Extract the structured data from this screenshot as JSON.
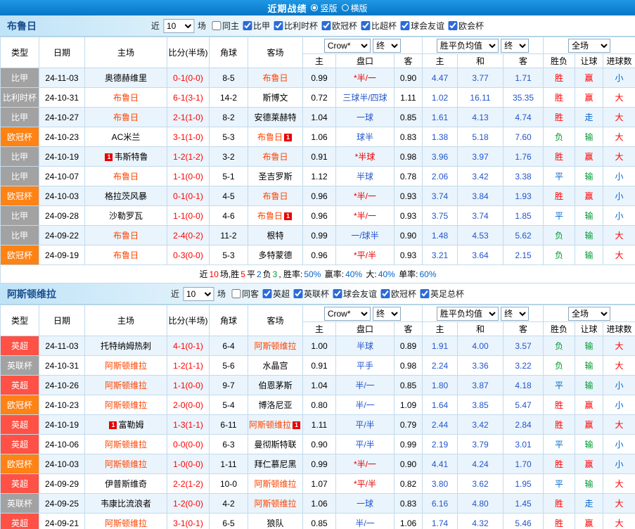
{
  "topbar": {
    "title": "近期战绩",
    "radio_vertical": "竖版",
    "radio_horizontal": "横版"
  },
  "colors": {
    "topbar_bg": "#0b82d2",
    "border": "#c2dbec",
    "row_alt": "#eaf4fc",
    "focus_team": "#ff4400",
    "score": "#ff0000",
    "handicap_normal": "#2255cc",
    "handicap_star": "#e60000",
    "euro_odds": "#2255cc",
    "card_badge": "#e80000"
  },
  "league_colors": {
    "比甲": "#a2a2a2",
    "比利时杯": "#a2a2a2",
    "英联杯": "#a2a2a2",
    "欧冠杯": "#ff8214",
    "英超": "#ff5145"
  },
  "result_colors": {
    "胜": "#ff0000",
    "赢": "#ff0000",
    "大": "#ff0000",
    "平": "#0066cc",
    "走": "#0066cc",
    "小": "#0066cc",
    "负": "#009933",
    "输": "#009933"
  },
  "sections": [
    {
      "team": "布鲁日",
      "filter": {
        "recent_label": "近",
        "count": "10",
        "matches_label": "场",
        "checkboxes": [
          {
            "label": "同主",
            "checked": false
          },
          {
            "label": "比甲",
            "checked": true
          },
          {
            "label": "比利时杯",
            "checked": true
          },
          {
            "label": "欧冠杯",
            "checked": true
          },
          {
            "label": "比超杯",
            "checked": true
          },
          {
            "label": "球会友谊",
            "checked": true
          },
          {
            "label": "欧会杯",
            "checked": true
          }
        ]
      },
      "header": {
        "type": "类型",
        "date": "日期",
        "home": "主场",
        "score": "比分(半场)",
        "corner": "角球",
        "away": "客场",
        "odds_select": "Crow*",
        "final_select": "终",
        "asia_home": "主",
        "handicap": "盘口",
        "asia_away": "客",
        "euro_select": "胜平负均值",
        "final_select2": "终",
        "euro_home": "主",
        "euro_draw": "和",
        "euro_away": "客",
        "full_select": "全场",
        "res_wdl": "胜负",
        "res_handicap": "让球",
        "res_goals": "进球数"
      },
      "rows": [
        {
          "league": "比甲",
          "date": "24-11-03",
          "home": "奥德赫维里",
          "home_focus": false,
          "home_card": "",
          "score": "0-1(0-0)",
          "corner": "8-5",
          "away": "布鲁日",
          "away_focus": true,
          "away_card": "",
          "asia_home": "0.99",
          "handicap": "*半/一",
          "asia_away": "0.90",
          "euro_home": "4.47",
          "euro_draw": "3.77",
          "euro_away": "1.71",
          "wdl": "胜",
          "let": "赢",
          "goal": "小"
        },
        {
          "league": "比利时杯",
          "date": "24-10-31",
          "home": "布鲁日",
          "home_focus": true,
          "home_card": "",
          "score": "6-1(3-1)",
          "corner": "14-2",
          "away": "斯博文",
          "away_focus": false,
          "away_card": "",
          "asia_home": "0.72",
          "handicap": "三球半/四球",
          "asia_away": "1.11",
          "euro_home": "1.02",
          "euro_draw": "16.11",
          "euro_away": "35.35",
          "wdl": "胜",
          "let": "赢",
          "goal": "大"
        },
        {
          "league": "比甲",
          "date": "24-10-27",
          "home": "布鲁日",
          "home_focus": true,
          "home_card": "",
          "score": "2-1(1-0)",
          "corner": "8-2",
          "away": "安德莱赫特",
          "away_focus": false,
          "away_card": "",
          "asia_home": "1.04",
          "handicap": "一球",
          "asia_away": "0.85",
          "euro_home": "1.61",
          "euro_draw": "4.13",
          "euro_away": "4.74",
          "wdl": "胜",
          "let": "走",
          "goal": "大"
        },
        {
          "league": "欧冠杯",
          "date": "24-10-23",
          "home": "AC米兰",
          "home_focus": false,
          "home_card": "",
          "score": "3-1(1-0)",
          "corner": "5-3",
          "away": "布鲁日",
          "away_focus": true,
          "away_card": "1",
          "asia_home": "1.06",
          "handicap": "球半",
          "asia_away": "0.83",
          "euro_home": "1.38",
          "euro_draw": "5.18",
          "euro_away": "7.60",
          "wdl": "负",
          "let": "输",
          "goal": "大"
        },
        {
          "league": "比甲",
          "date": "24-10-19",
          "home": "韦斯特鲁",
          "home_focus": false,
          "home_card": "1",
          "score": "1-2(1-2)",
          "corner": "3-2",
          "away": "布鲁日",
          "away_focus": true,
          "away_card": "",
          "asia_home": "0.91",
          "handicap": "*半球",
          "asia_away": "0.98",
          "euro_home": "3.96",
          "euro_draw": "3.97",
          "euro_away": "1.76",
          "wdl": "胜",
          "let": "赢",
          "goal": "大"
        },
        {
          "league": "比甲",
          "date": "24-10-07",
          "home": "布鲁日",
          "home_focus": true,
          "home_card": "",
          "score": "1-1(0-0)",
          "corner": "5-1",
          "away": "圣吉罗斯",
          "away_focus": false,
          "away_card": "",
          "asia_home": "1.12",
          "handicap": "半球",
          "asia_away": "0.78",
          "euro_home": "2.06",
          "euro_draw": "3.42",
          "euro_away": "3.38",
          "wdl": "平",
          "let": "输",
          "goal": "小"
        },
        {
          "league": "欧冠杯",
          "date": "24-10-03",
          "home": "格拉茨风暴",
          "home_focus": false,
          "home_card": "",
          "score": "0-1(0-1)",
          "corner": "4-5",
          "away": "布鲁日",
          "away_focus": true,
          "away_card": "",
          "asia_home": "0.96",
          "handicap": "*半/一",
          "asia_away": "0.93",
          "euro_home": "3.74",
          "euro_draw": "3.84",
          "euro_away": "1.93",
          "wdl": "胜",
          "let": "赢",
          "goal": "小"
        },
        {
          "league": "比甲",
          "date": "24-09-28",
          "home": "沙勒罗瓦",
          "home_focus": false,
          "home_card": "",
          "score": "1-1(0-0)",
          "corner": "4-6",
          "away": "布鲁日",
          "away_focus": true,
          "away_card": "1",
          "asia_home": "0.96",
          "handicap": "*半/一",
          "asia_away": "0.93",
          "euro_home": "3.75",
          "euro_draw": "3.74",
          "euro_away": "1.85",
          "wdl": "平",
          "let": "输",
          "goal": "小"
        },
        {
          "league": "比甲",
          "date": "24-09-22",
          "home": "布鲁日",
          "home_focus": true,
          "home_card": "",
          "score": "2-4(0-2)",
          "corner": "11-2",
          "away": "根特",
          "away_focus": false,
          "away_card": "",
          "asia_home": "0.99",
          "handicap": "一/球半",
          "asia_away": "0.90",
          "euro_home": "1.48",
          "euro_draw": "4.53",
          "euro_away": "5.62",
          "wdl": "负",
          "let": "输",
          "goal": "大"
        },
        {
          "league": "欧冠杯",
          "date": "24-09-19",
          "home": "布鲁日",
          "home_focus": true,
          "home_card": "",
          "score": "0-3(0-0)",
          "corner": "5-3",
          "away": "多特蒙德",
          "away_focus": false,
          "away_card": "",
          "asia_home": "0.96",
          "handicap": "*平/半",
          "asia_away": "0.93",
          "euro_home": "3.21",
          "euro_draw": "3.64",
          "euro_away": "2.15",
          "wdl": "负",
          "let": "输",
          "goal": "大"
        }
      ],
      "summary": [
        {
          "t": "近",
          "c": "#000000"
        },
        {
          "t": "10",
          "c": "#ff0000"
        },
        {
          "t": "场,胜",
          "c": "#000000"
        },
        {
          "t": "5",
          "c": "#ff0000"
        },
        {
          "t": "平",
          "c": "#000000"
        },
        {
          "t": "2",
          "c": "#0066cc"
        },
        {
          "t": "负",
          "c": "#000000"
        },
        {
          "t": "3",
          "c": "#009933"
        },
        {
          "t": ", 胜率:",
          "c": "#000000"
        },
        {
          "t": "50%",
          "c": "#0066cc"
        },
        {
          "t": " 赢率:",
          "c": "#000000"
        },
        {
          "t": "40%",
          "c": "#0066cc"
        },
        {
          "t": " 大:",
          "c": "#000000"
        },
        {
          "t": "40%",
          "c": "#0066cc"
        },
        {
          "t": " 单率:",
          "c": "#000000"
        },
        {
          "t": "60%",
          "c": "#0066cc"
        }
      ]
    },
    {
      "team": "阿斯顿维拉",
      "filter": {
        "recent_label": "近",
        "count": "10",
        "matches_label": "场",
        "checkboxes": [
          {
            "label": "同客",
            "checked": false
          },
          {
            "label": "英超",
            "checked": true
          },
          {
            "label": "英联杯",
            "checked": true
          },
          {
            "label": "球会友谊",
            "checked": true
          },
          {
            "label": "欧冠杯",
            "checked": true
          },
          {
            "label": "英足总杯",
            "checked": true
          }
        ]
      },
      "header": {
        "type": "类型",
        "date": "日期",
        "home": "主场",
        "score": "比分(半场)",
        "corner": "角球",
        "away": "客场",
        "odds_select": "Crow*",
        "final_select": "终",
        "asia_home": "主",
        "handicap": "盘口",
        "asia_away": "客",
        "euro_select": "胜平负均值",
        "final_select2": "终",
        "euro_home": "主",
        "euro_draw": "和",
        "euro_away": "客",
        "full_select": "全场",
        "res_wdl": "胜负",
        "res_handicap": "让球",
        "res_goals": "进球数"
      },
      "rows": [
        {
          "league": "英超",
          "date": "24-11-03",
          "home": "托特纳姆热刺",
          "home_focus": false,
          "home_card": "",
          "score": "4-1(0-1)",
          "corner": "6-4",
          "away": "阿斯顿维拉",
          "away_focus": true,
          "away_card": "",
          "asia_home": "1.00",
          "handicap": "半球",
          "asia_away": "0.89",
          "euro_home": "1.91",
          "euro_draw": "4.00",
          "euro_away": "3.57",
          "wdl": "负",
          "let": "输",
          "goal": "大"
        },
        {
          "league": "英联杯",
          "date": "24-10-31",
          "home": "阿斯顿维拉",
          "home_focus": true,
          "home_card": "",
          "score": "1-2(1-1)",
          "corner": "5-6",
          "away": "水晶宫",
          "away_focus": false,
          "away_card": "",
          "asia_home": "0.91",
          "handicap": "平手",
          "asia_away": "0.98",
          "euro_home": "2.24",
          "euro_draw": "3.36",
          "euro_away": "3.22",
          "wdl": "负",
          "let": "输",
          "goal": "大"
        },
        {
          "league": "英超",
          "date": "24-10-26",
          "home": "阿斯顿维拉",
          "home_focus": true,
          "home_card": "",
          "score": "1-1(0-0)",
          "corner": "9-7",
          "away": "伯恩茅斯",
          "away_focus": false,
          "away_card": "",
          "asia_home": "1.04",
          "handicap": "半/一",
          "asia_away": "0.85",
          "euro_home": "1.80",
          "euro_draw": "3.87",
          "euro_away": "4.18",
          "wdl": "平",
          "let": "输",
          "goal": "小"
        },
        {
          "league": "欧冠杯",
          "date": "24-10-23",
          "home": "阿斯顿维拉",
          "home_focus": true,
          "home_card": "",
          "score": "2-0(0-0)",
          "corner": "5-4",
          "away": "博洛尼亚",
          "away_focus": false,
          "away_card": "",
          "asia_home": "0.80",
          "handicap": "半/一",
          "asia_away": "1.09",
          "euro_home": "1.64",
          "euro_draw": "3.85",
          "euro_away": "5.47",
          "wdl": "胜",
          "let": "赢",
          "goal": "小"
        },
        {
          "league": "英超",
          "date": "24-10-19",
          "home": "富勒姆",
          "home_focus": false,
          "home_card": "1",
          "score": "1-3(1-1)",
          "corner": "6-11",
          "away": "阿斯顿维拉",
          "away_focus": true,
          "away_card": "1",
          "asia_home": "1.11",
          "handicap": "平/半",
          "asia_away": "0.79",
          "euro_home": "2.44",
          "euro_draw": "3.42",
          "euro_away": "2.84",
          "wdl": "胜",
          "let": "赢",
          "goal": "大"
        },
        {
          "league": "英超",
          "date": "24-10-06",
          "home": "阿斯顿维拉",
          "home_focus": true,
          "home_card": "",
          "score": "0-0(0-0)",
          "corner": "6-3",
          "away": "曼彻斯特联",
          "away_focus": false,
          "away_card": "",
          "asia_home": "0.90",
          "handicap": "平/半",
          "asia_away": "0.99",
          "euro_home": "2.19",
          "euro_draw": "3.79",
          "euro_away": "3.01",
          "wdl": "平",
          "let": "输",
          "goal": "小"
        },
        {
          "league": "欧冠杯",
          "date": "24-10-03",
          "home": "阿斯顿维拉",
          "home_focus": true,
          "home_card": "",
          "score": "1-0(0-0)",
          "corner": "1-11",
          "away": "拜仁慕尼黑",
          "away_focus": false,
          "away_card": "",
          "asia_home": "0.99",
          "handicap": "*半/一",
          "asia_away": "0.90",
          "euro_home": "4.41",
          "euro_draw": "4.24",
          "euro_away": "1.70",
          "wdl": "胜",
          "let": "赢",
          "goal": "小"
        },
        {
          "league": "英超",
          "date": "24-09-29",
          "home": "伊普斯维奇",
          "home_focus": false,
          "home_card": "",
          "score": "2-2(1-2)",
          "corner": "10-0",
          "away": "阿斯顿维拉",
          "away_focus": true,
          "away_card": "",
          "asia_home": "1.07",
          "handicap": "*平/半",
          "asia_away": "0.82",
          "euro_home": "3.80",
          "euro_draw": "3.62",
          "euro_away": "1.95",
          "wdl": "平",
          "let": "输",
          "goal": "大"
        },
        {
          "league": "英联杯",
          "date": "24-09-25",
          "home": "韦康比流浪者",
          "home_focus": false,
          "home_card": "",
          "score": "1-2(0-0)",
          "corner": "4-2",
          "away": "阿斯顿维拉",
          "away_focus": true,
          "away_card": "",
          "asia_home": "1.06",
          "handicap": "一球",
          "asia_away": "0.83",
          "euro_home": "6.16",
          "euro_draw": "4.80",
          "euro_away": "1.45",
          "wdl": "胜",
          "let": "走",
          "goal": "大"
        },
        {
          "league": "英超",
          "date": "24-09-21",
          "home": "阿斯顿维拉",
          "home_focus": true,
          "home_card": "",
          "score": "3-1(0-1)",
          "corner": "6-5",
          "away": "狼队",
          "away_focus": false,
          "away_card": "",
          "asia_home": "0.85",
          "handicap": "半/一",
          "asia_away": "1.06",
          "euro_home": "1.74",
          "euro_draw": "4.32",
          "euro_away": "5.46",
          "wdl": "胜",
          "let": "赢",
          "goal": "大"
        }
      ]
    }
  ]
}
